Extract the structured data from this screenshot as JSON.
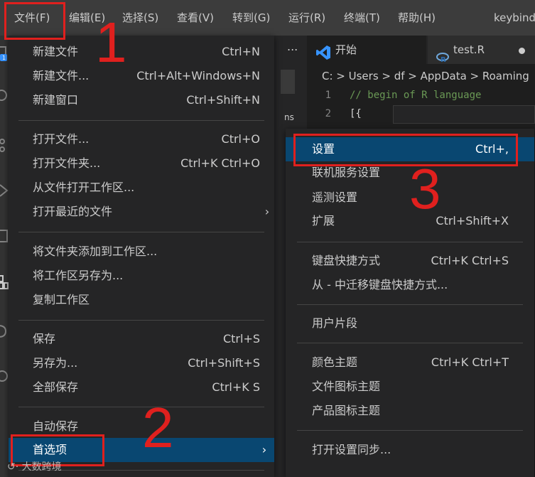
{
  "menubar": {
    "items": [
      "文件(F)",
      "编辑(E)",
      "选择(S)",
      "查看(V)",
      "转到(G)",
      "运行(R)",
      "终端(T)",
      "帮助(H)"
    ],
    "title": "keybindings"
  },
  "editor": {
    "tabs": [
      {
        "label": "开始",
        "icon": "vscode-logo-icon"
      },
      {
        "label": "test.R",
        "icon": "r-language-icon",
        "modified": true
      }
    ],
    "breadcrumb": "C: > Users > df > AppData > Roaming",
    "sidebar_text": "ns",
    "sidebar_dots": "...",
    "lines": [
      {
        "num": "1",
        "text": "// begin of R language"
      },
      {
        "num": "2",
        "text": "[{"
      }
    ]
  },
  "file_menu": {
    "groups": [
      [
        {
          "label": "新建文件",
          "shortcut": "Ctrl+N"
        },
        {
          "label": "新建文件...",
          "shortcut": "Ctrl+Alt+Windows+N"
        },
        {
          "label": "新建窗口",
          "shortcut": "Ctrl+Shift+N"
        }
      ],
      [
        {
          "label": "打开文件...",
          "shortcut": "Ctrl+O"
        },
        {
          "label": "打开文件夹...",
          "shortcut": "Ctrl+K Ctrl+O"
        },
        {
          "label": "从文件打开工作区...",
          "shortcut": ""
        },
        {
          "label": "打开最近的文件",
          "shortcut": "",
          "submenu": true
        }
      ],
      [
        {
          "label": "将文件夹添加到工作区...",
          "shortcut": ""
        },
        {
          "label": "将工作区另存为...",
          "shortcut": ""
        },
        {
          "label": "复制工作区",
          "shortcut": ""
        }
      ],
      [
        {
          "label": "保存",
          "shortcut": "Ctrl+S"
        },
        {
          "label": "另存为...",
          "shortcut": "Ctrl+Shift+S"
        },
        {
          "label": "全部保存",
          "shortcut": "Ctrl+K S"
        }
      ],
      [
        {
          "label": "自动保存",
          "shortcut": ""
        },
        {
          "label": "首选项",
          "shortcut": "",
          "submenu": true,
          "selected": true
        }
      ]
    ]
  },
  "preferences_menu": {
    "groups": [
      [
        {
          "label": "设置",
          "shortcut": "Ctrl+,",
          "selected": true
        },
        {
          "label": "联机服务设置",
          "shortcut": ""
        },
        {
          "label": "遥测设置",
          "shortcut": ""
        },
        {
          "label": "扩展",
          "shortcut": "Ctrl+Shift+X"
        }
      ],
      [
        {
          "label": "键盘快捷方式",
          "shortcut": "Ctrl+K Ctrl+S"
        },
        {
          "label": "从 - 中迁移键盘快捷方式...",
          "shortcut": ""
        }
      ],
      [
        {
          "label": "用户片段",
          "shortcut": ""
        }
      ],
      [
        {
          "label": "颜色主题",
          "shortcut": "Ctrl+K Ctrl+T"
        },
        {
          "label": "文件图标主题",
          "shortcut": ""
        },
        {
          "label": "产品图标主题",
          "shortcut": ""
        }
      ],
      [
        {
          "label": "打开设置同步...",
          "shortcut": ""
        }
      ]
    ]
  },
  "annotations": {
    "step1": "1",
    "step2": "2",
    "step3": "3",
    "color": "#e0201e"
  },
  "watermark": "大数跨境",
  "colors": {
    "menu_bg": "#252526",
    "selection": "#094771",
    "menubar_bg": "#3c3c3c",
    "accent_vscode": "#3794ff"
  }
}
